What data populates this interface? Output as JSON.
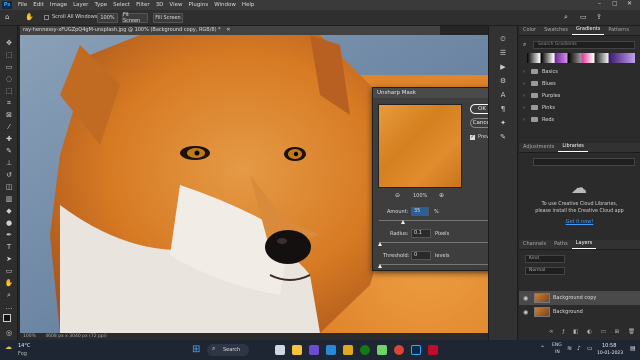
{
  "menubar": {
    "logo": "Ps",
    "items": [
      "File",
      "Edit",
      "Image",
      "Layer",
      "Type",
      "Select",
      "Filter",
      "3D",
      "View",
      "Plugins",
      "Window",
      "Help"
    ]
  },
  "options": {
    "scroll_all_windows": "Scroll All Windows",
    "zoom_value": "100%",
    "fit_screen": "Fit Screen",
    "fill_screen": "Fill Screen"
  },
  "document": {
    "tab_title": "ray-hennessy-xFUGZpQ4gM-unsplash.jpg @ 100% (Background copy, RGB/8) *",
    "status": "100%",
    "doc_info": "4608 px x 3040 px (72 ppi)"
  },
  "right_panels": {
    "top_tabs": [
      "Color",
      "Swatches",
      "Gradients",
      "Patterns"
    ],
    "active_top_tab": "Gradients",
    "search_placeholder": "Search Gradients",
    "gradient_groups": [
      "Basics",
      "Blues",
      "Purples",
      "Pinks",
      "Reds"
    ],
    "mid_tabs": [
      "Adjustments",
      "Libraries"
    ],
    "active_mid_tab": "Libraries",
    "cc_message_line1": "To use Creative Cloud Libraries,",
    "cc_message_line2": "please install the Creative Cloud app",
    "get_it_now": "Get it now!",
    "layers_tabs": [
      "Channels",
      "Paths",
      "Layers"
    ],
    "active_layers_tab": "Layers",
    "layer_kind": "Kind",
    "blend_mode": "Normal",
    "layers": [
      {
        "name": "Background copy",
        "selected": true
      },
      {
        "name": "Background",
        "selected": false
      }
    ]
  },
  "dialog": {
    "title": "Unsharp Mask",
    "ok": "OK",
    "cancel": "Cancel",
    "preview": "Preview",
    "zoom": "100%",
    "amount_label": "Amount:",
    "amount_value": "35",
    "amount_unit": "%",
    "radius_label": "Radius:",
    "radius_value": "0.1",
    "radius_unit": "Pixels",
    "threshold_label": "Threshold:",
    "threshold_value": "0",
    "threshold_unit": "levels"
  },
  "taskbar": {
    "weather_temp": "14°C",
    "weather_desc": "Fog",
    "search": "Search",
    "language": "ENG",
    "region": "IN",
    "time": "10:58",
    "date": "10-01-2023"
  },
  "colors": {
    "accent": "#31a8ff",
    "ok_button": "#1473e6",
    "link": "#3f9cff"
  }
}
